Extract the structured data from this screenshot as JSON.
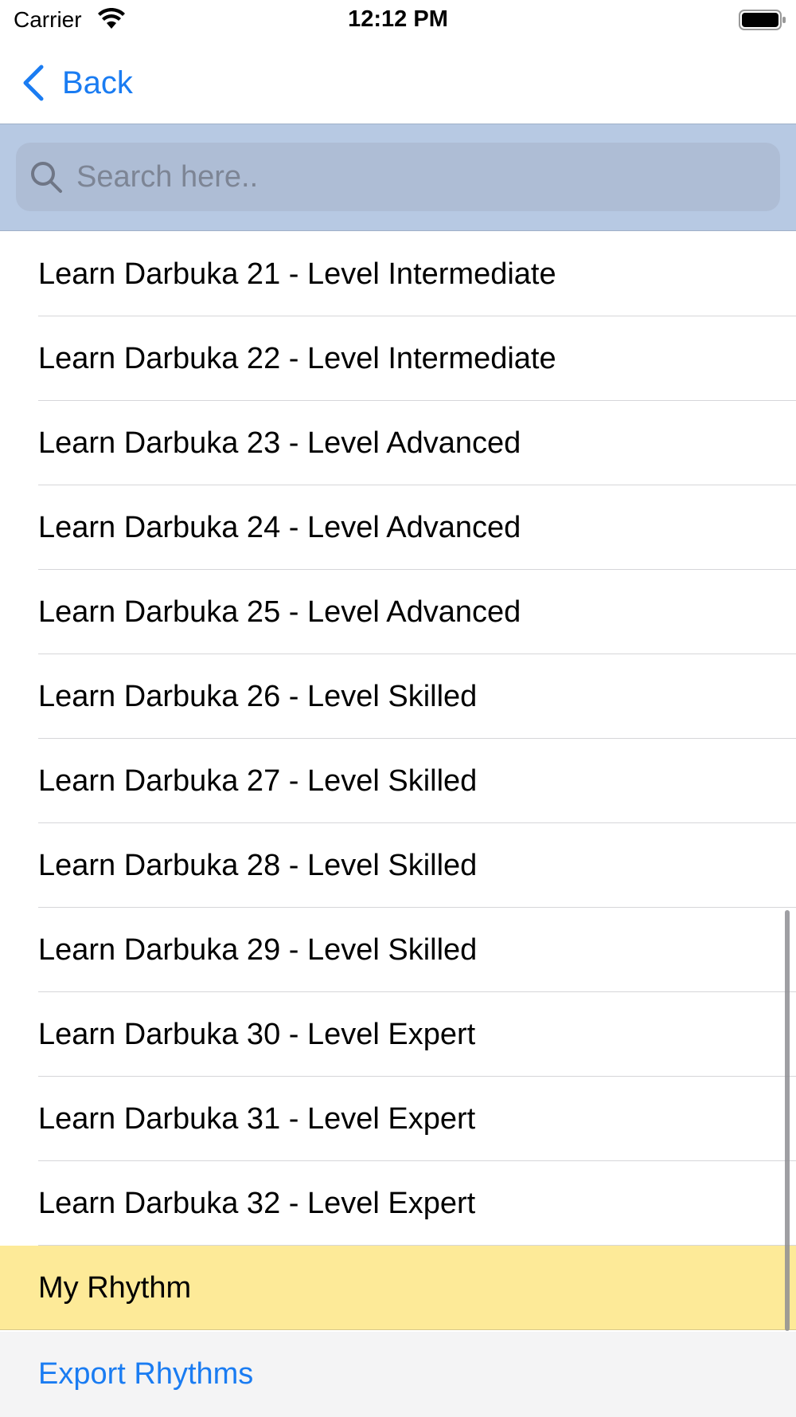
{
  "status_bar": {
    "carrier": "Carrier",
    "time": "12:12 PM",
    "icons": [
      "wifi-icon",
      "battery-icon"
    ]
  },
  "nav": {
    "back_label": "Back",
    "back_icon": "chevron-left-icon",
    "accent_color": "#1a7cf2"
  },
  "search": {
    "placeholder": "Search here..",
    "value": "",
    "icon": "search-icon",
    "bar_color": "#b7c9e3"
  },
  "list": {
    "items": [
      {
        "label": "Learn Darbuka 21 - Level Intermediate"
      },
      {
        "label": "Learn Darbuka 22 - Level Intermediate"
      },
      {
        "label": "Learn Darbuka 23 - Level Advanced"
      },
      {
        "label": "Learn Darbuka 24 - Level Advanced"
      },
      {
        "label": "Learn Darbuka 25 - Level Advanced"
      },
      {
        "label": "Learn Darbuka 26 - Level Skilled"
      },
      {
        "label": "Learn Darbuka 27 - Level Skilled"
      },
      {
        "label": "Learn Darbuka 28 - Level Skilled"
      },
      {
        "label": "Learn Darbuka 29 - Level Skilled"
      },
      {
        "label": "Learn Darbuka 30 - Level Expert"
      },
      {
        "label": "Learn Darbuka 31 - Level Expert"
      },
      {
        "label": "Learn Darbuka 32 - Level Expert"
      }
    ],
    "highlighted_item": {
      "label": "My Rhythm",
      "color": "#fdea98"
    }
  },
  "footer": {
    "export_label": "Export Rhythms"
  }
}
